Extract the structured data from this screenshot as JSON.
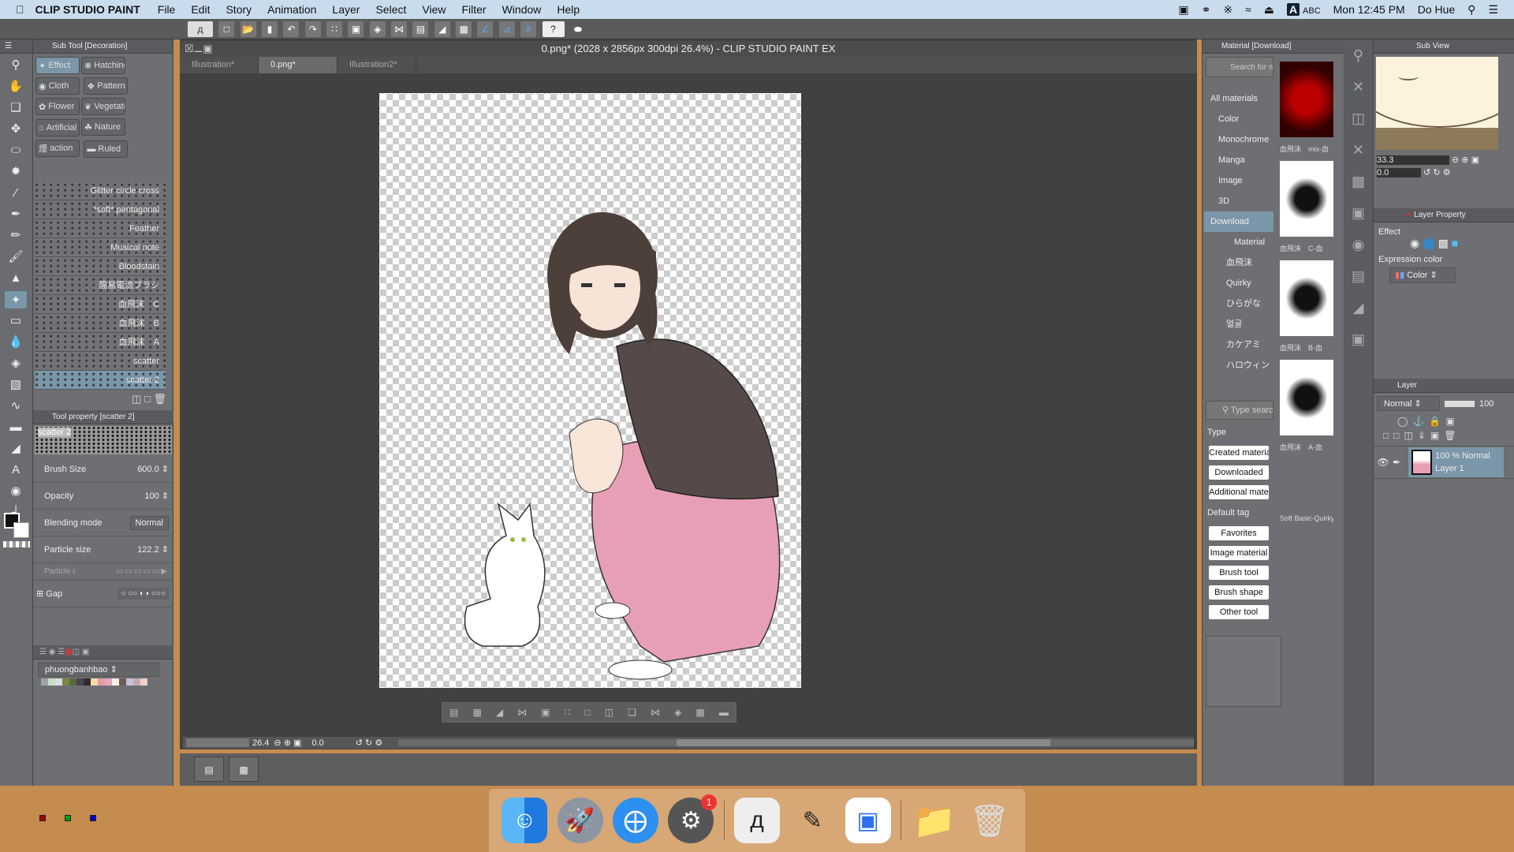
{
  "menubar": {
    "app": "CLIP STUDIO PAINT",
    "items": [
      "File",
      "Edit",
      "Story",
      "Animation",
      "Layer",
      "Select",
      "View",
      "Filter",
      "Window",
      "Help"
    ],
    "input": "ABC",
    "clock": "Mon 12:45 PM",
    "user": "Do Hue"
  },
  "document": {
    "title": "0.png* (2028 x 2856px 300dpi 26.4%)  - CLIP STUDIO PAINT EX",
    "tabs": [
      "Illustration*",
      "0.png*",
      "Illustration2*"
    ],
    "active_tab": 1
  },
  "subtool": {
    "title": "Sub Tool [Decoration]",
    "groups": [
      "Effect",
      "Hatching",
      "Cloth",
      "Pattern",
      "Flower",
      "Vegetation",
      "Artificial",
      "Nature",
      "action",
      "Ruled"
    ],
    "brushes": [
      "Glitter circle cross",
      "*soft* pentagonal",
      "Feather",
      "Musical note",
      "Bloodstain",
      "簡易電流ブラシ",
      "血飛沫　C",
      "血飛沫　B",
      "血飛沫　A",
      "scatter",
      "scatter 2"
    ],
    "selected": "scatter 2"
  },
  "toolproperty": {
    "title": "Tool property [scatter 2]",
    "preview_name": "scatter 2",
    "brush_size_label": "Brush Size",
    "brush_size": "600.0",
    "opacity_label": "Opacity",
    "opacity": "100",
    "blend_label": "Blending mode",
    "blend": "Normal",
    "particle_label": "Particle size",
    "particle": "122.2",
    "density_label": "Particle density",
    "gap_label": "Gap"
  },
  "palette": {
    "name": "phuongbanhbao",
    "swatches": [
      "#9aa5a3",
      "#c9dcc7",
      "#d8dfe0",
      "#7b8744",
      "#556b3a",
      "#4a4350",
      "#312a33",
      "#f5dca8",
      "#e49aa0",
      "#e7a6bd",
      "#f8efe3",
      "#6e5a5c",
      "#c3c2d6",
      "#c4aab6",
      "#f1d2c6"
    ],
    "basic": [
      "#a00000",
      "#00a000",
      "#0000c8"
    ]
  },
  "status": {
    "zoom": "26.4",
    "rotation": "0.0"
  },
  "material": {
    "title": "Material [Download]",
    "search": "Search for materials",
    "tree": [
      "All materials",
      "Color",
      "Monochrome",
      "Manga",
      "Image",
      "3D",
      "Download",
      "Material",
      "血飛沫",
      "Quirky",
      "ひらがな",
      "얼굴",
      "カケアミ",
      "ハロウィン"
    ],
    "items": [
      "血飛沫　mix-血",
      "血飛沫　C-血",
      "血飛沫　B-血",
      "血飛沫　A-血",
      "Soft Basic-Quirky"
    ],
    "tag_search": "Type search...",
    "type_label": "Type",
    "types": [
      "Created material",
      "Downloaded",
      "Additional material"
    ],
    "default_tag_label": "Default tag",
    "tags": [
      "Favorites",
      "Image material",
      "Brush tool",
      "Brush shape",
      "Other tool"
    ]
  },
  "subview": {
    "title": "Sub View",
    "zoom": "33.3",
    "rotation": "0.0"
  },
  "layerproperty": {
    "title": "Layer Property",
    "effect_label": "Effect",
    "expression_label": "Expression color",
    "expression": "Color"
  },
  "layers": {
    "title": "Layer",
    "blend": "Normal",
    "opacity": "100",
    "items": [
      {
        "mode": "100 % Normal",
        "name": "Layer 1"
      }
    ]
  },
  "dock": {
    "badge": "1",
    "apps": [
      "Finder",
      "Launchpad",
      "Safari",
      "System Preferences",
      "Clip Studio",
      "Clip Studio Paint",
      "Zoom",
      "Downloads",
      "Trash"
    ]
  }
}
